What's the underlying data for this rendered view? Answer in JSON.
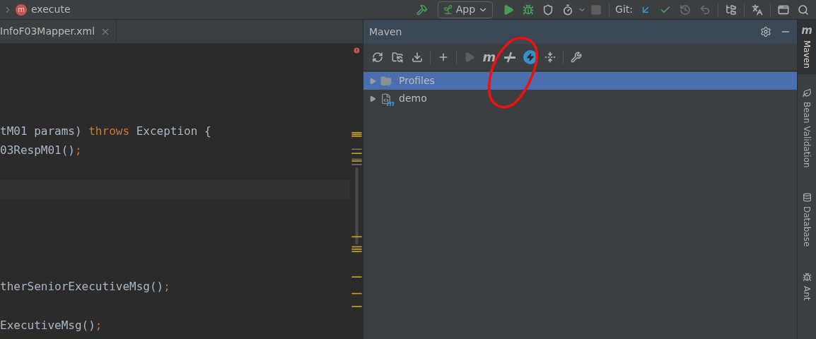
{
  "toolbar": {
    "breadcrumb": {
      "badge": "m",
      "label": "execute"
    },
    "run_config": "App",
    "git_label": "Git:"
  },
  "editor": {
    "tab": {
      "label": "InfoF03Mapper.xml"
    },
    "lines": [
      {
        "kind": "blank"
      },
      {
        "kind": "blank"
      },
      {
        "kind": "blank"
      },
      {
        "kind": "blank"
      },
      {
        "kind": "code",
        "tokens": [
          {
            "text": "tM01 params) ",
            "kind": "plain"
          },
          {
            "text": "throws",
            "kind": "keyword"
          },
          {
            "text": " Exception {",
            "kind": "plain"
          }
        ]
      },
      {
        "kind": "code",
        "tokens": [
          {
            "text": "03RespM01()",
            "kind": "plain"
          },
          {
            "text": ";",
            "kind": "keyword"
          }
        ]
      },
      {
        "kind": "blank"
      },
      {
        "kind": "caret_line"
      },
      {
        "kind": "blank"
      },
      {
        "kind": "blank"
      },
      {
        "kind": "blank"
      },
      {
        "kind": "blank"
      },
      {
        "kind": "code",
        "tokens": [
          {
            "text": "therSeniorExecutiveMsg()",
            "kind": "plain"
          },
          {
            "text": ";",
            "kind": "keyword"
          }
        ]
      },
      {
        "kind": "blank"
      },
      {
        "kind": "code",
        "tokens": [
          {
            "text": "ExecutiveMsg()",
            "kind": "plain"
          },
          {
            "text": ";",
            "kind": "keyword"
          }
        ]
      }
    ]
  },
  "maven": {
    "title": "Maven",
    "goal_text": "m",
    "module_badge": "m",
    "tree": [
      {
        "label": "Profiles",
        "selected": true,
        "kind": "profiles"
      },
      {
        "label": "demo",
        "selected": false,
        "kind": "module"
      }
    ]
  },
  "stripe": [
    {
      "label": "Maven",
      "selected": true,
      "kind": "maven",
      "icon_text": "m"
    },
    {
      "label": "Bean Validation",
      "selected": false,
      "kind": "bean"
    },
    {
      "label": "Database",
      "selected": false,
      "kind": "database"
    },
    {
      "label": "Ant",
      "selected": false,
      "kind": "ant"
    }
  ]
}
